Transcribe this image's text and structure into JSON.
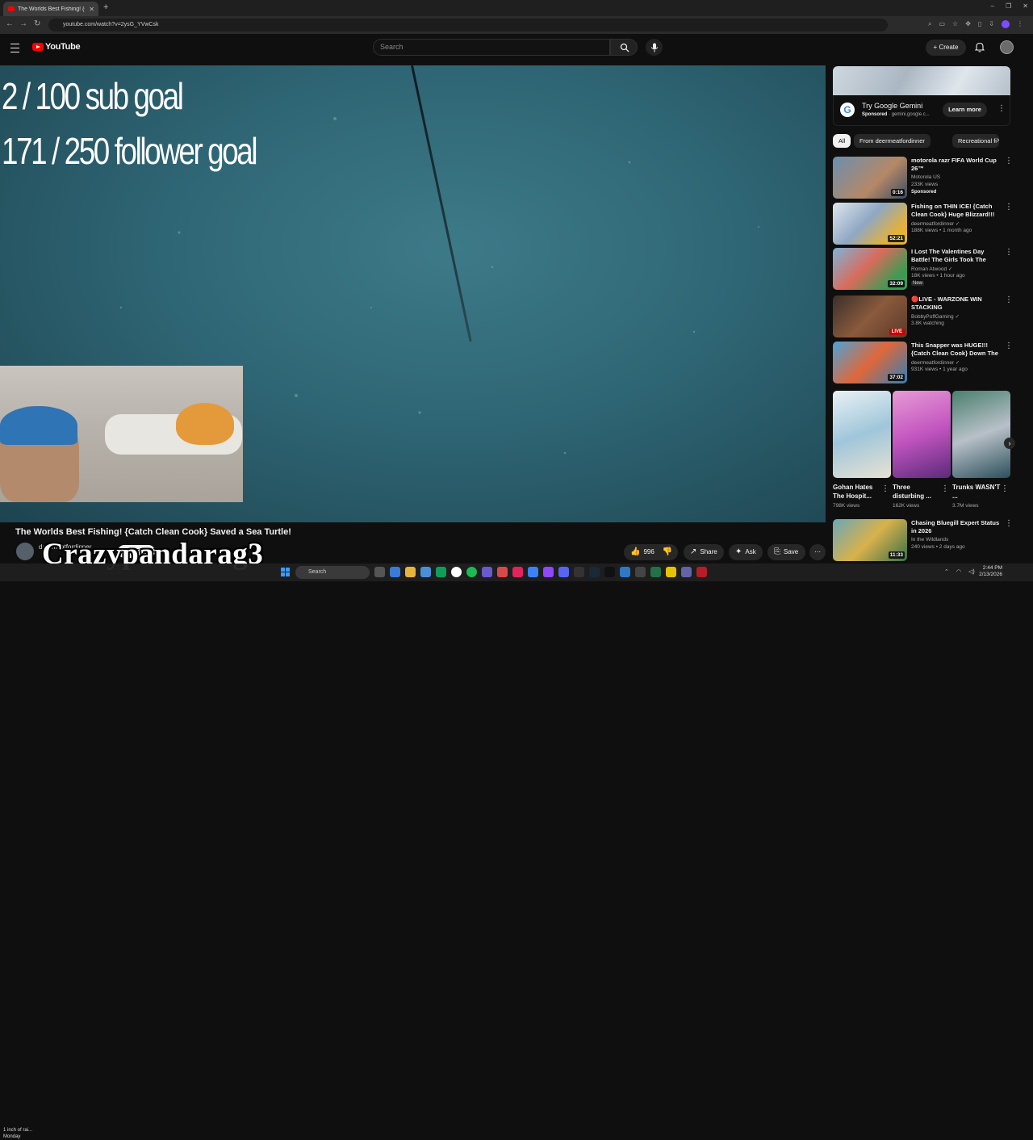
{
  "browser": {
    "tab_title": "The Worlds Best Fishing! {Ca",
    "new_tab": "+",
    "url": "youtube.com/watch?v=2ysG_YVwCsk",
    "window_controls": [
      "–",
      "❐",
      "✕"
    ]
  },
  "header": {
    "logo_text": "YouTube",
    "search_placeholder": "Search",
    "create_label": "+ Create"
  },
  "player": {
    "overlay_line1": "2  / 100 sub goal",
    "overlay_line2": "171 / 250 follower goal"
  },
  "video": {
    "title": "The Worlds Best Fishing! {Catch Clean Cook} Saved a Sea Turtle!",
    "channel": "deermeatfordinner",
    "subscribe_label": "Subscribe",
    "likes": "996",
    "share_label": "Share",
    "ask_label": "Ask",
    "save_label": "Save",
    "more_label": "⋯"
  },
  "stream_overlay": {
    "watermark": "Crazypandarag3"
  },
  "ad": {
    "title": "Try Google Gemini",
    "sponsored": "Sponsored",
    "domain": "gemini.google.c...",
    "learn_more": "Learn more"
  },
  "chips": [
    "All",
    "From deermeatfordinner",
    "Recreational fi"
  ],
  "recommendations": [
    {
      "title": "motorola razr FIFA World Cup 26™",
      "channel": "Motorola US",
      "meta": "233K views",
      "badge": "Sponsored",
      "duration": "0:16",
      "live": false
    },
    {
      "title": "Fishing on THIN ICE! {Catch Clean Cook} Huge Blizzard!!!",
      "channel": "deermeatfordinner ✓",
      "meta": "188K views • 1 month ago",
      "badge": "",
      "duration": "52:21",
      "live": false
    },
    {
      "title": "I Lost The Valentines Day Battle! The Girls Took The Camera ...",
      "channel": "Roman Atwood ✓",
      "meta": "18K views • 1 hour ago",
      "badge": "New",
      "duration": "32:09",
      "live": false
    },
    {
      "title": "🔴LIVE - WARZONE WIN STACKING",
      "channel": "BobbyPoffGaming ✓",
      "meta": "3.8K watching",
      "badge": "",
      "duration": "LIVE",
      "live": true
    },
    {
      "title": "This Snapper was HUGE!!! {Catch Clean Cook} Down The ...",
      "channel": "deermeatfordinner ✓",
      "meta": "931K views • 1 year ago",
      "badge": "",
      "duration": "37:02",
      "live": false
    }
  ],
  "shorts": [
    {
      "title": "Gohan Hates The Hospit...",
      "views": "798K views"
    },
    {
      "title": "Three disturbing ...",
      "views": "162K views"
    },
    {
      "title": "Trunks WASN'T ...",
      "views": "3.7M views"
    }
  ],
  "last_rec": {
    "title": "Chasing Bluegill Expert Status in 2026",
    "channel": "In the Wildlands",
    "meta": "240 views • 2 days ago",
    "duration": "11:33"
  },
  "taskbar": {
    "weather_line1": "1 inch of rai...",
    "weather_line2": "Monday",
    "search_label": "Search",
    "time": "2:44 PM",
    "date": "2/13/2026"
  },
  "colors": {
    "youtube_red": "#ff0000",
    "background": "#0f0f0f",
    "chip_bg": "#272727",
    "water": "#2f6675"
  }
}
